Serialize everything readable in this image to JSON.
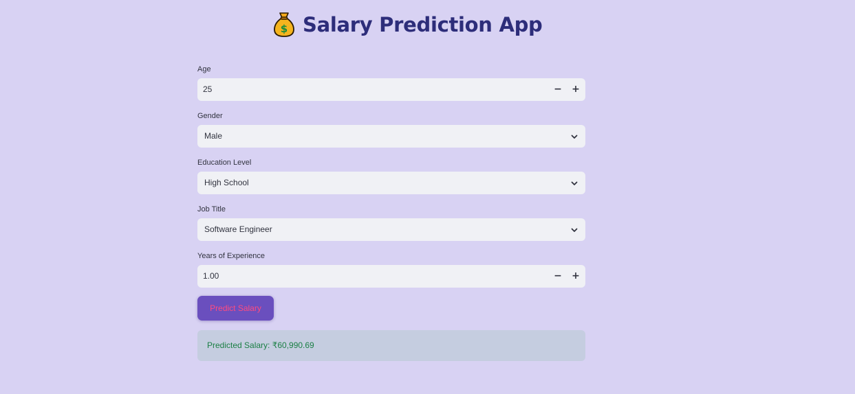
{
  "app": {
    "title": "Salary Prediction App",
    "title_icon": "money-bag-icon"
  },
  "form": {
    "age": {
      "label": "Age",
      "value": "25",
      "decrement": "−",
      "increment": "+"
    },
    "gender": {
      "label": "Gender",
      "selected": "Male",
      "icon": "chevron-down-icon"
    },
    "education_level": {
      "label": "Education Level",
      "selected": "High School",
      "icon": "chevron-down-icon"
    },
    "job_title": {
      "label": "Job Title",
      "selected": "Software Engineer",
      "icon": "chevron-down-icon"
    },
    "years_of_experience": {
      "label": "Years of Experience",
      "value": "1.00",
      "decrement": "−",
      "increment": "+"
    }
  },
  "predict_button": {
    "label": "Predict Salary"
  },
  "result": {
    "text": "Predicted Salary: ₹60,990.69"
  },
  "colors": {
    "background": "#d8d2f3",
    "title": "#2d2d7a",
    "input_background": "#f0f1f5",
    "button_background": "#6a4fbe",
    "button_text": "#ff4b80",
    "result_background": "#c5cde0",
    "result_text": "#1a7f44"
  }
}
